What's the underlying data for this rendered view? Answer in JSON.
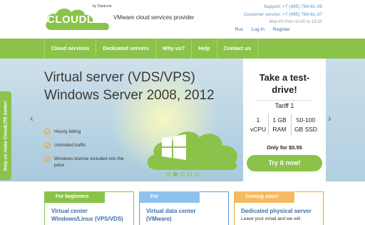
{
  "header": {
    "logo_text": "CLOUDLITE",
    "logo_by": "by DataLine",
    "tagline": "VMware cloud services provider",
    "support_label": "Support: +7 (495) 784-61-39",
    "customer_label": "Customer service: +7 (495) 784-61-37",
    "hours": "Mon-Fri from 10:00 to 18:30",
    "links": [
      "Rus",
      "Log In",
      "Register"
    ]
  },
  "nav": [
    "Cloud services",
    "Dedicated servers",
    "Why us?",
    "Help",
    "Contact us"
  ],
  "banner": {
    "title_line1": "Virtual server (VDS/VPS)",
    "title_line2": "Windows Server 2008, 2012",
    "features": [
      "Hourly billing",
      "Unlimited traffic",
      "Windows license included into the price"
    ],
    "prev_arrow": "‹",
    "next_arrow": "›",
    "slides_total": 5,
    "slide_active": 2
  },
  "panel": {
    "title": "Take a test-drive!",
    "tariff": "Tariff 1",
    "specs": [
      {
        "top": "1",
        "bottom": "vCPU"
      },
      {
        "top": "1 GB",
        "bottom": "RAM"
      },
      {
        "top": "50-100",
        "bottom": "GB SSD"
      }
    ],
    "price": "Only for $0.55",
    "button": "Try it now!"
  },
  "sidetab": "Help us make CloudLITE better!",
  "cards": [
    {
      "tag": "For beginners",
      "link_line1": "Virtual center",
      "link_line2": "Windows/Linux (VPS/VDS)",
      "text": ""
    },
    {
      "tag": "For professionals",
      "link_line1": "Virtual data center",
      "link_line2": "(VMware)",
      "text": ""
    },
    {
      "tag": "Coming soon!",
      "link_line1": "Dedicated physical server",
      "link_line2": "",
      "text": "Leave your email and we will"
    }
  ],
  "colors": {
    "accent_green": "#8bc34a",
    "link_blue": "#3d6fa8",
    "orange": "#f0a52c",
    "blue": "#8ec2ee"
  }
}
